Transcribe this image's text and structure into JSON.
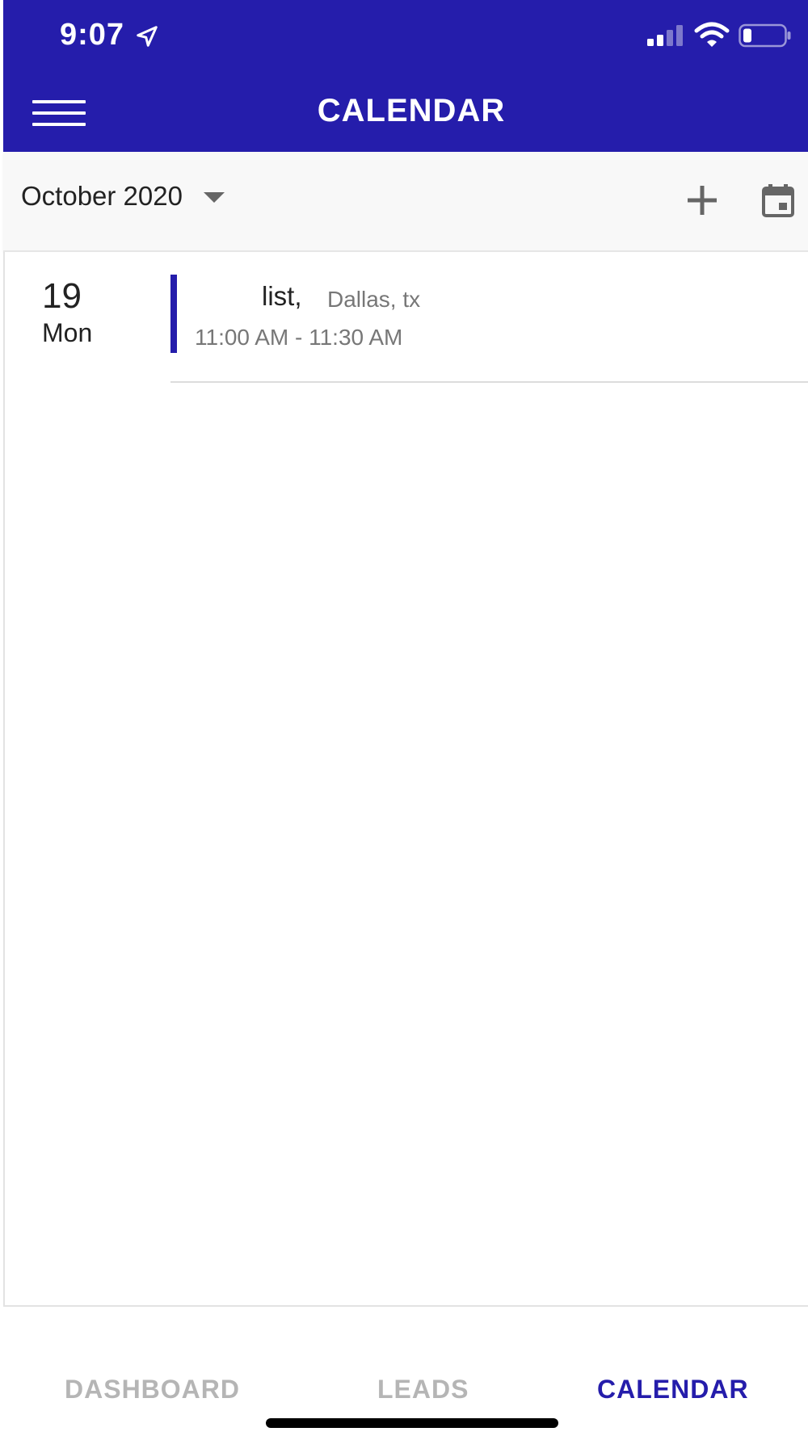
{
  "status_bar": {
    "time": "9:07",
    "icons": [
      "location-arrow-icon",
      "cellular-signal-icon",
      "wifi-icon",
      "battery-icon"
    ]
  },
  "header": {
    "title": "CALENDAR",
    "menu_icon": "hamburger-menu-icon",
    "background_color": "#251dab"
  },
  "toolbar": {
    "month": "October 2020",
    "dropdown_icon": "caret-down-icon",
    "add_icon": "plus-icon",
    "calendar_icon": "calendar-icon"
  },
  "events": [
    {
      "day_number": "19",
      "day_name": "Mon",
      "title": "list,",
      "location": "Dallas, tx",
      "time_range": "11:00 AM - 11:30 AM",
      "accent_color": "#251dab"
    }
  ],
  "bottom_nav": {
    "items": [
      {
        "label": "DASHBOARD",
        "active": false
      },
      {
        "label": "LEADS",
        "active": false
      },
      {
        "label": "CALENDAR",
        "active": true
      }
    ],
    "active_color": "#251dab",
    "inactive_color": "#b5b5b5"
  }
}
